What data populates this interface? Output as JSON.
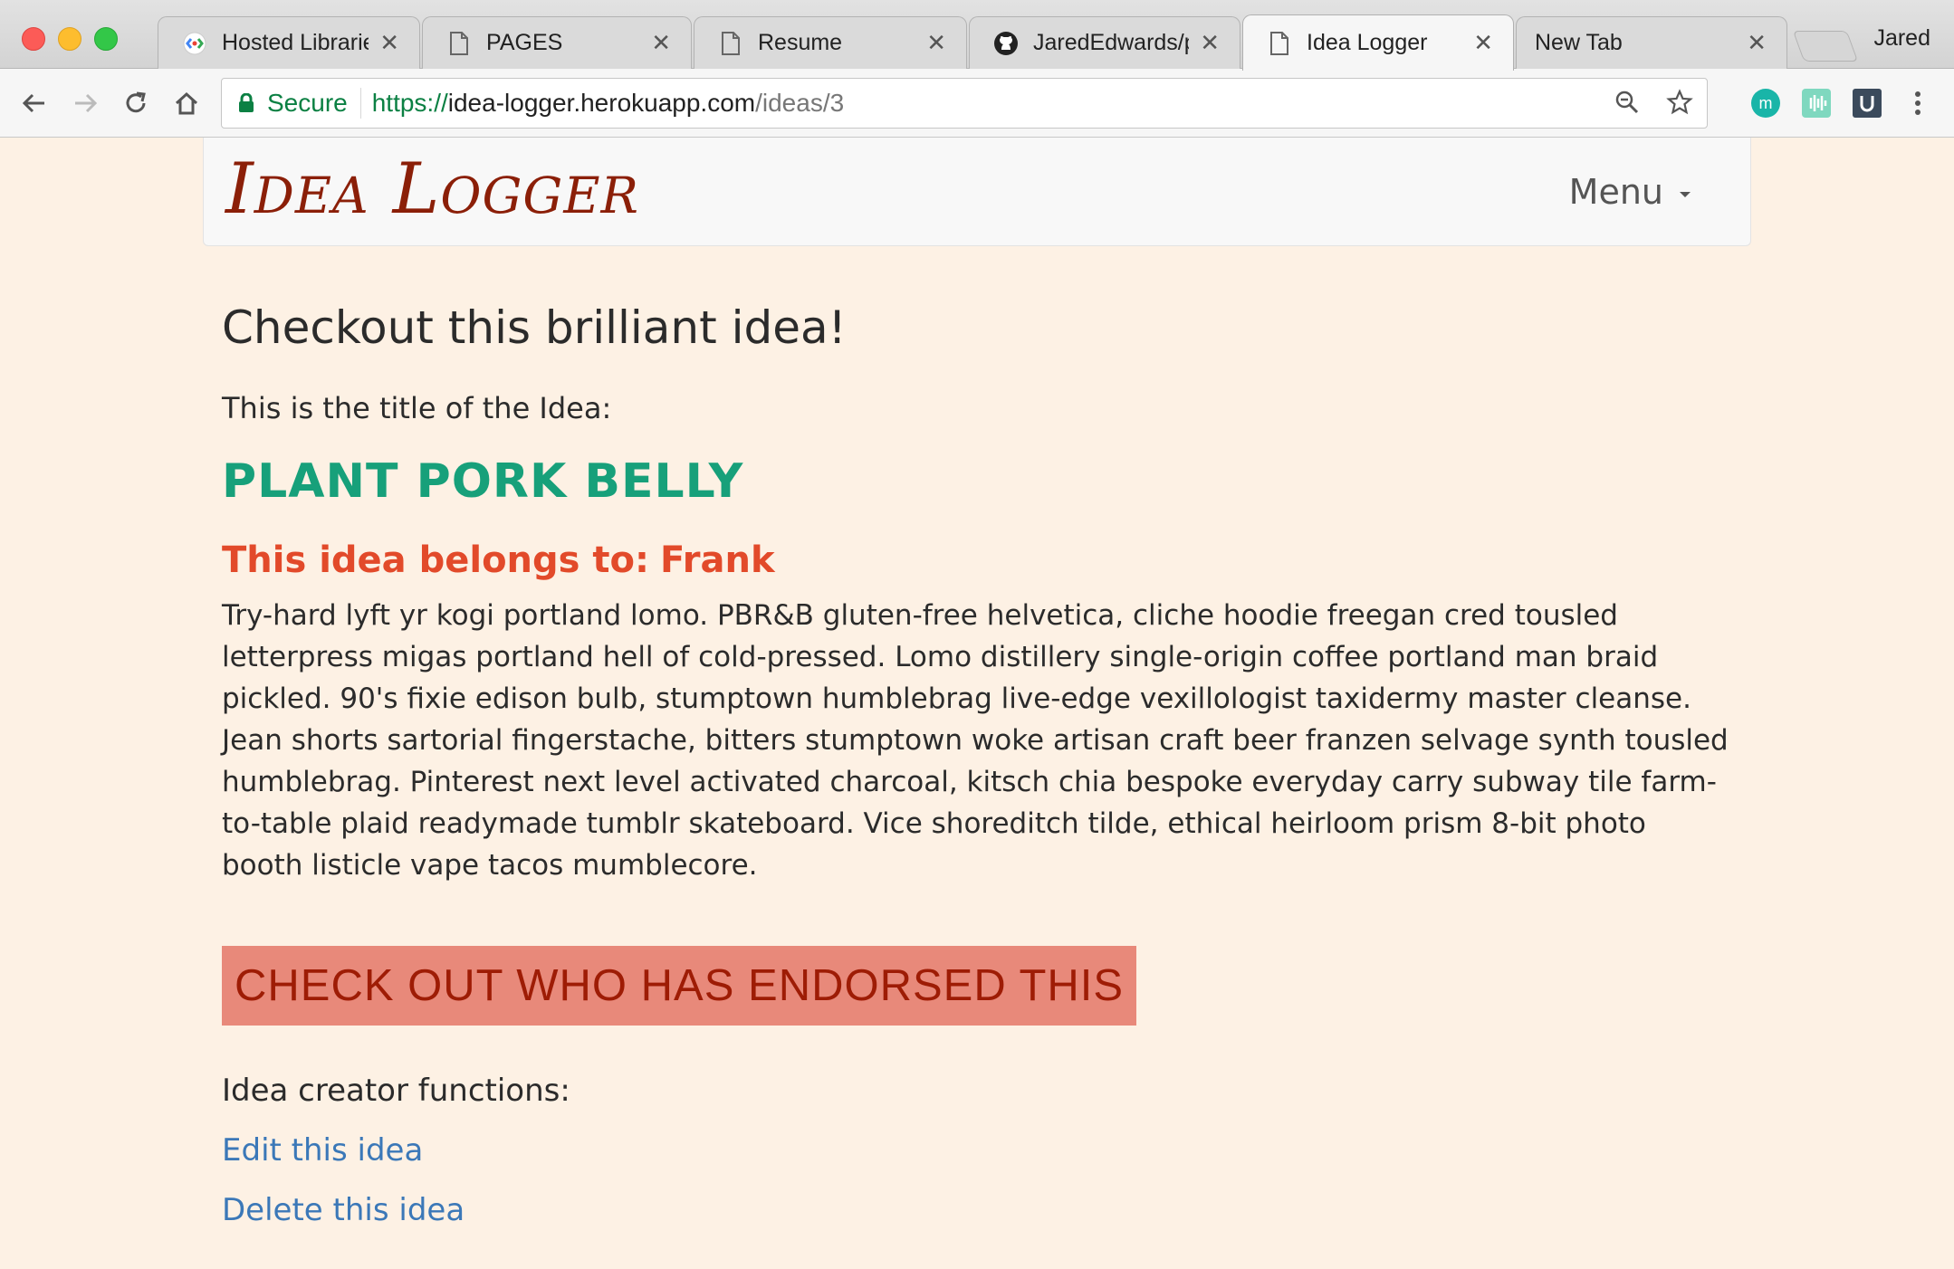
{
  "browser": {
    "tabs": [
      {
        "label": "Hosted Libraries",
        "icon": "google-developers-icon",
        "active": false
      },
      {
        "label": "PAGES",
        "icon": "page-icon",
        "active": false
      },
      {
        "label": "Resume",
        "icon": "page-icon",
        "active": false
      },
      {
        "label": "JaredEdwards/pr",
        "icon": "github-icon",
        "active": false
      },
      {
        "label": "Idea Logger",
        "icon": "page-icon",
        "active": true
      },
      {
        "label": "New Tab",
        "icon": "",
        "active": false
      }
    ],
    "profile_name": "Jared",
    "secure_label": "Secure",
    "url": {
      "scheme": "https://",
      "host": "idea-logger.herokuapp.com",
      "path": "/ideas/3"
    },
    "colors": {
      "secure_green": "#0b8043"
    }
  },
  "app": {
    "brand": "Idea Logger",
    "menu_label": "Menu"
  },
  "idea": {
    "heading": "Checkout this brilliant idea!",
    "title_label": "This is the title of the Idea:",
    "title": "PLANT PORK BELLY",
    "owner_label": "This idea belongs to:",
    "owner_name": "Frank",
    "description": "Try-hard lyft yr kogi portland lomo. PBR&B gluten-free helvetica, cliche hoodie freegan cred tousled letterpress migas portland hell of cold-pressed. Lomo distillery single-origin coffee portland man braid pickled. 90's fixie edison bulb, stumptown humblebrag live-edge vexillologist taxidermy master cleanse. Jean shorts sartorial fingerstache, bitters stumptown woke artisan craft beer franzen selvage synth tousled humblebrag. Pinterest next level activated charcoal, kitsch chia bespoke everyday carry subway tile farm-to-table plaid readymade tumblr skateboard. Vice shoreditch tilde, ethical heirloom prism 8-bit photo booth listicle vape tacos mumblecore.",
    "endorse_button": "CHECK OUT WHO HAS ENDORSED THIS",
    "creator_label": "Idea creator functions:",
    "edit_link": "Edit this idea",
    "delete_link": "Delete this idea"
  },
  "theme": {
    "page_bg": "#fdf1e4",
    "brand_color": "#8b1f08",
    "title_color": "#17a07a",
    "owner_color": "#e24a2a",
    "button_bg": "#e8897a",
    "button_text": "#9e1c05",
    "link_color": "#3b78b8"
  }
}
